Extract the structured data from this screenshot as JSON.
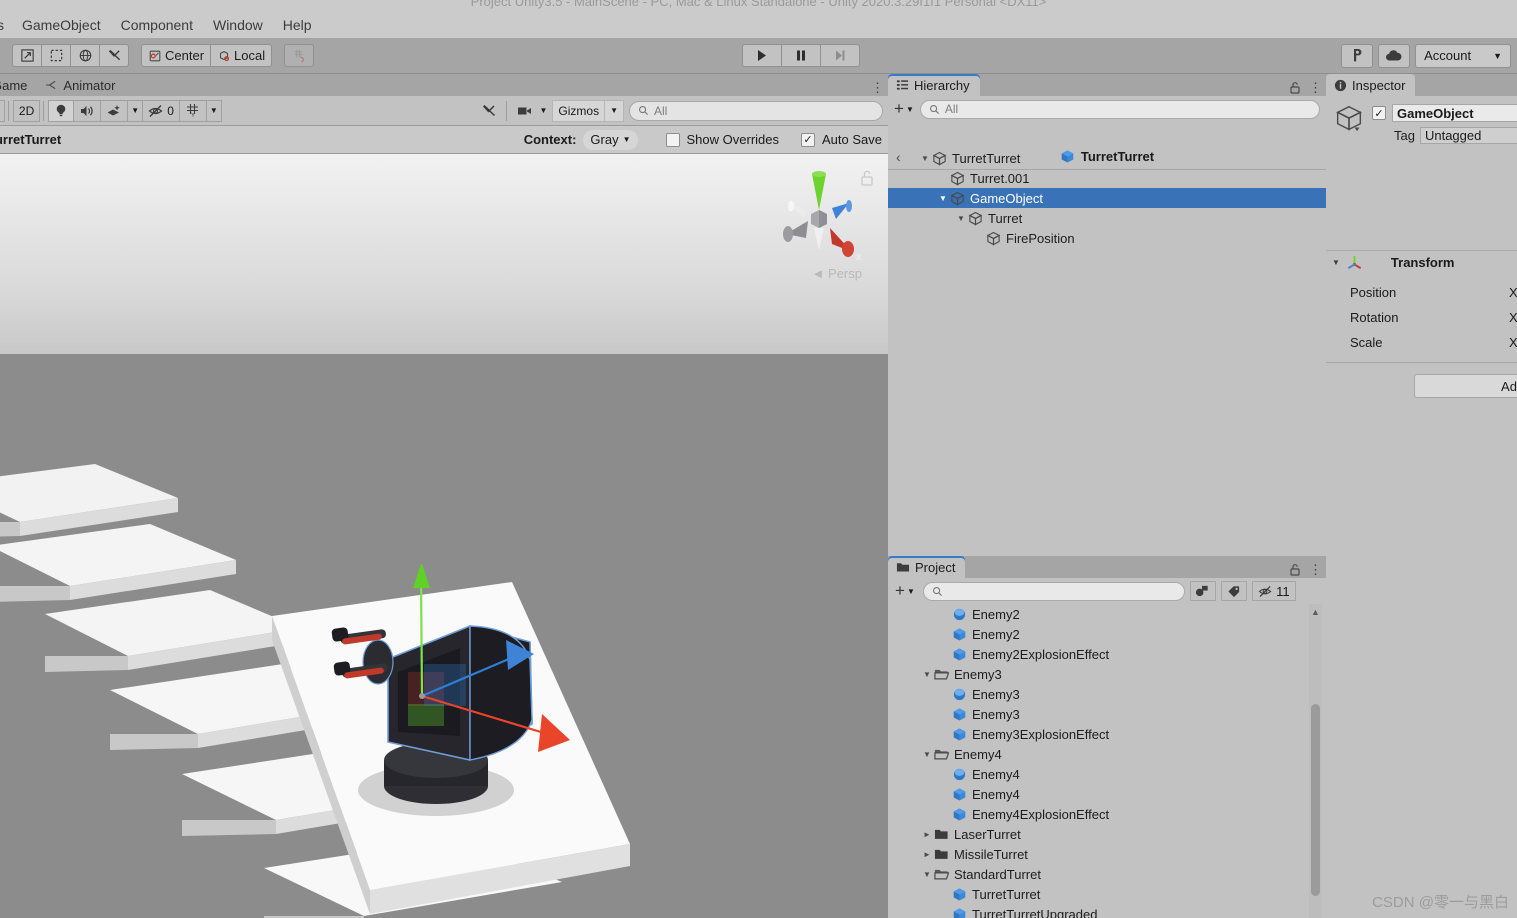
{
  "window": {
    "title": "Project Unity3.5 - MainScene - PC, Mac & Linux Standalone - Unity 2020.3.29f1f1 Personal <DX11>"
  },
  "menubar": {
    "items": [
      {
        "label": "s",
        "name": "menu-assets-clipped"
      },
      {
        "label": "GameObject",
        "name": "menu-gameobject"
      },
      {
        "label": "Component",
        "name": "menu-component"
      },
      {
        "label": "Window",
        "name": "menu-window"
      },
      {
        "label": "Help",
        "name": "menu-help"
      }
    ]
  },
  "toolbar": {
    "transform_tools": [
      {
        "name": "move-tool",
        "icon": "move-arrow-icon",
        "glyph": "⇗"
      },
      {
        "name": "rect-tool",
        "icon": "rect-transform-icon",
        "glyph": "⬚"
      },
      {
        "name": "rotate-tool",
        "icon": "rotate-icon",
        "glyph": "◍"
      },
      {
        "name": "custom-tool",
        "icon": "tools-icon",
        "glyph": "⚒"
      }
    ],
    "pivot_label": "Center",
    "handle_label": "Local",
    "snap_label": "",
    "play_label": "▶",
    "pause_label": "❚❚",
    "step_label": "▶❙",
    "collab_icon": "collab-icon",
    "cloud_icon": "cloud-icon",
    "account_label": "Account",
    "account_caret": "▼"
  },
  "scene": {
    "tabs": [
      {
        "label": "Game",
        "name": "tab-game",
        "active": false,
        "icon": ""
      },
      {
        "label": "Animator",
        "name": "tab-animator",
        "active": false,
        "icon": "animator-icon"
      }
    ],
    "toolbar": {
      "draw_mode_caret": "▼",
      "mode_2d": "2D",
      "lighting_icon": "lightbulb-icon",
      "audio_icon": "speaker-icon",
      "fx_icon": "effects-icon",
      "fx_caret": "▼",
      "hidden_count": "0",
      "hidden_icon": "eye-off-icon",
      "grid_icon": "grid-icon",
      "grid_caret": "▼",
      "tools_icon": "tools-icon",
      "camera_icon": "camera-icon",
      "camera_caret": "▼",
      "gizmos_label": "Gizmos",
      "gizmos_caret": "▼",
      "search_placeholder": "All",
      "search_value": ""
    },
    "context_bar": {
      "prefab_name": "TurretTurret",
      "context_label": "Context:",
      "context_value": "Gray",
      "context_caret": "▼",
      "show_overrides_label": "Show Overrides",
      "show_overrides_checked": false,
      "auto_save_label": "Auto Save",
      "auto_save_checked": true,
      "auto_save_check": "✓"
    },
    "viewport": {
      "persp_label": "◄ Persp",
      "gizmo_axes": [
        "x",
        "y",
        "z"
      ],
      "axis_x_color": "#d13b2a",
      "axis_y_color": "#5ec72a",
      "axis_z_color": "#2d7fd4",
      "lock_icon": "unlock-icon"
    }
  },
  "hierarchy": {
    "tab_label": "Hierarchy",
    "tab_icon": "hierarchy-icon",
    "lock_icon": "lock-icon",
    "menu_icon": "kebab-menu-icon",
    "add_label": "+",
    "add_caret": "▼",
    "search_placeholder": "All",
    "search_value": "",
    "breadcrumb_back": "‹",
    "breadcrumb_title": "TurretTurret",
    "breadcrumb_icon": "prefab-cube-icon",
    "tree": [
      {
        "label": "TurretTurret",
        "depth": 0,
        "expanded": true,
        "selected": false,
        "icon": "gameobject-icon"
      },
      {
        "label": "Turret.001",
        "depth": 1,
        "expanded": null,
        "selected": false,
        "icon": "gameobject-icon"
      },
      {
        "label": "GameObject",
        "depth": 1,
        "expanded": true,
        "selected": true,
        "icon": "gameobject-icon"
      },
      {
        "label": "Turret",
        "depth": 2,
        "expanded": true,
        "selected": false,
        "icon": "gameobject-icon"
      },
      {
        "label": "FirePosition",
        "depth": 3,
        "expanded": null,
        "selected": false,
        "icon": "gameobject-icon"
      }
    ]
  },
  "project": {
    "tab_label": "Project",
    "tab_icon": "folder-icon",
    "lock_icon": "lock-icon",
    "menu_icon": "kebab-menu-icon",
    "add_label": "+",
    "add_caret": "▼",
    "search_placeholder": "",
    "search_value": "",
    "filter_type_icon": "filter-type-icon",
    "filter_label_icon": "filter-tag-icon",
    "hidden_icon": "eye-off-icon",
    "hidden_count": "11",
    "tree": [
      {
        "label": "Enemy2",
        "depth": 2,
        "expanded": null,
        "icon": "sphere-icon"
      },
      {
        "label": "Enemy2",
        "depth": 2,
        "expanded": null,
        "icon": "prefab-cube-icon"
      },
      {
        "label": "Enemy2ExplosionEffect",
        "depth": 2,
        "expanded": null,
        "icon": "prefab-cube-icon"
      },
      {
        "label": "Enemy3",
        "depth": 1,
        "expanded": true,
        "icon": "folder-open-icon"
      },
      {
        "label": "Enemy3",
        "depth": 2,
        "expanded": null,
        "icon": "sphere-icon"
      },
      {
        "label": "Enemy3",
        "depth": 2,
        "expanded": null,
        "icon": "prefab-cube-icon"
      },
      {
        "label": "Enemy3ExplosionEffect",
        "depth": 2,
        "expanded": null,
        "icon": "prefab-cube-icon"
      },
      {
        "label": "Enemy4",
        "depth": 1,
        "expanded": true,
        "icon": "folder-open-icon"
      },
      {
        "label": "Enemy4",
        "depth": 2,
        "expanded": null,
        "icon": "sphere-icon"
      },
      {
        "label": "Enemy4",
        "depth": 2,
        "expanded": null,
        "icon": "prefab-cube-icon"
      },
      {
        "label": "Enemy4ExplosionEffect",
        "depth": 2,
        "expanded": null,
        "icon": "prefab-cube-icon"
      },
      {
        "label": "LaserTurret",
        "depth": 1,
        "expanded": false,
        "icon": "folder-icon"
      },
      {
        "label": "MissileTurret",
        "depth": 1,
        "expanded": false,
        "icon": "folder-icon"
      },
      {
        "label": "StandardTurret",
        "depth": 1,
        "expanded": true,
        "icon": "folder-open-icon"
      },
      {
        "label": "TurretTurret",
        "depth": 2,
        "expanded": null,
        "icon": "prefab-cube-icon"
      },
      {
        "label": "TurretTurretUpgraded",
        "depth": 2,
        "expanded": null,
        "icon": "prefab-cube-icon"
      }
    ]
  },
  "inspector": {
    "tab_label": "Inspector",
    "tab_icon": "info-icon",
    "enabled_checked": true,
    "enabled_check": "✓",
    "object_name": "GameObject",
    "tag_label": "Tag",
    "tag_value": "Untagged",
    "component": {
      "title": "Transform",
      "icon": "transform-icon",
      "expanded": true,
      "expand_caret": "▼",
      "rows": [
        {
          "label": "Position",
          "axis": "X"
        },
        {
          "label": "Rotation",
          "axis": "X"
        },
        {
          "label": "Scale",
          "axis": "X"
        }
      ]
    },
    "add_component_label": "Ad"
  },
  "watermark": "CSDN @零一与黑白"
}
